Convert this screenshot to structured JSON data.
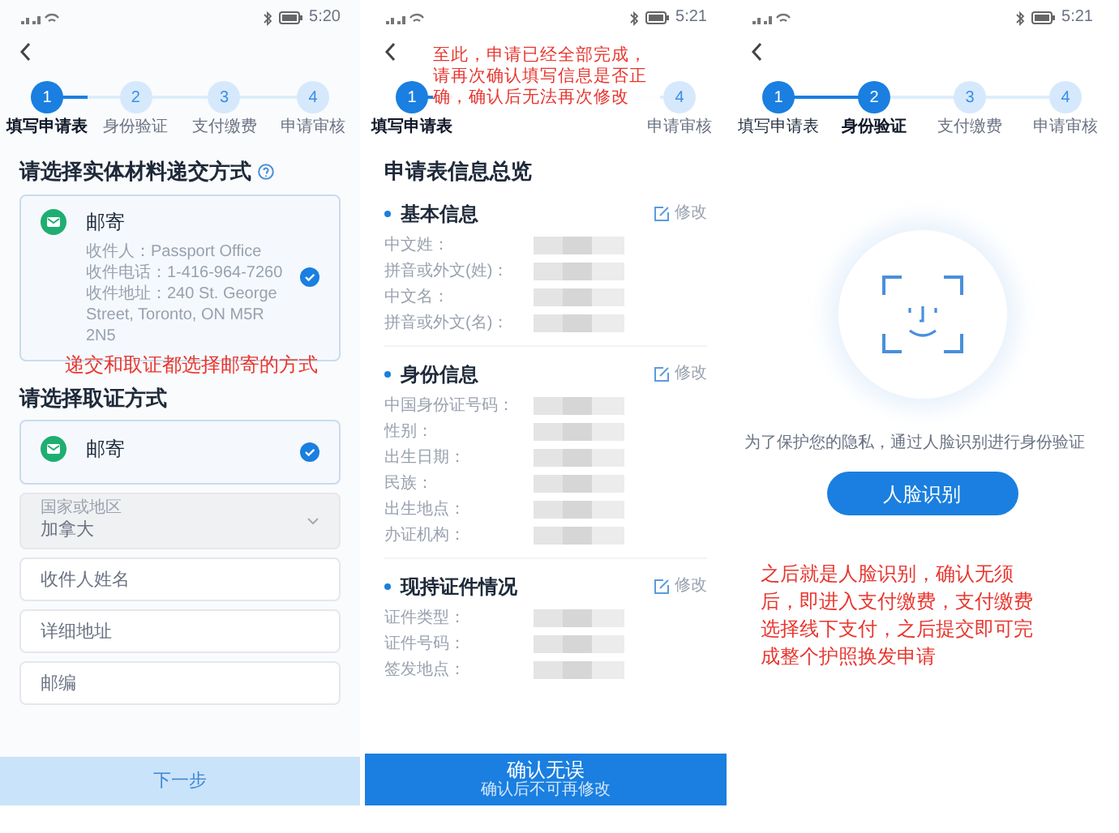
{
  "panels": [
    {
      "kind": "form",
      "status_bar": {
        "time": "5:20"
      },
      "steps": [
        {
          "num": "1",
          "label": "填写申请表",
          "active": true,
          "selected": true
        },
        {
          "num": "2",
          "label": "身份验证",
          "active": false,
          "selected": false
        },
        {
          "num": "3",
          "label": "支付缴费",
          "active": false,
          "selected": false
        },
        {
          "num": "4",
          "label": "申请审核",
          "active": false,
          "selected": false
        }
      ],
      "progress": {
        "level": 0.15
      },
      "submit_heading": "请选择实体材料递交方式",
      "submit_option": {
        "title": "邮寄",
        "selected": true,
        "lines": [
          "收件人：Passport Office",
          "收件电话：1-416-964-7260",
          "收件地址：240 St. George Street, Toronto, ON M5R 2N5"
        ]
      },
      "annotation": "递交和取证都选择邮寄的方式",
      "pickup_heading": "请选择取证方式",
      "pickup_option": {
        "title": "邮寄",
        "selected": true
      },
      "country_field": {
        "label": "国家或地区",
        "value": "加拿大",
        "disabled": true
      },
      "fields": [
        {
          "placeholder": "收件人姓名"
        },
        {
          "placeholder": "详细地址"
        },
        {
          "placeholder": "邮编"
        }
      ],
      "button": {
        "label": "下一步",
        "disabled": true
      }
    },
    {
      "kind": "summary",
      "status_bar": {
        "time": "5:21"
      },
      "steps": [
        {
          "num": "1",
          "label": "填写申请表",
          "active": true,
          "selected": true
        },
        {
          "num": "4",
          "label": "申请审核",
          "active": false,
          "selected": false
        }
      ],
      "progress": {
        "level": 0.15
      },
      "annotation": "至此，申请已经全部完成，请再次确认填写信息是否正确，确认后无法再次修改",
      "heading": "申请表信息总览",
      "sections": [
        {
          "title": "基本信息",
          "edit": "修改",
          "rows": [
            "中文姓：",
            "拼音或外文(姓)：",
            "中文名：",
            "拼音或外文(名)："
          ]
        },
        {
          "title": "身份信息",
          "edit": "修改",
          "rows": [
            "中国身份证号码：",
            "性别：",
            "出生日期：",
            "民族：",
            "出生地点：",
            "办证机构："
          ]
        },
        {
          "title": "现持证件情况",
          "edit": "修改",
          "rows": [
            "证件类型：",
            "证件号码：",
            "签发地点："
          ]
        }
      ],
      "button": {
        "label": "确认无误",
        "note": "确认后不可再修改",
        "disabled": false
      }
    },
    {
      "kind": "face",
      "status_bar": {
        "time": "5:21"
      },
      "steps": [
        {
          "num": "1",
          "label": "填写申请表",
          "active": true,
          "selected": false
        },
        {
          "num": "2",
          "label": "身份验证",
          "active": true,
          "selected": true
        },
        {
          "num": "3",
          "label": "支付缴费",
          "active": false,
          "selected": false
        },
        {
          "num": "4",
          "label": "申请审核",
          "active": false,
          "selected": false
        }
      ],
      "progress": {
        "level": 0.34
      },
      "privacy_note": "为了保护您的隐私，通过人脸识别进行身份验证",
      "button": {
        "label": "人脸识别",
        "disabled": false
      },
      "annotation": "之后就是人脸识别，确认无须后，即进入支付缴费，支付缴费选择线下支付，之后提交即可完成整个护照换发申请"
    }
  ]
}
